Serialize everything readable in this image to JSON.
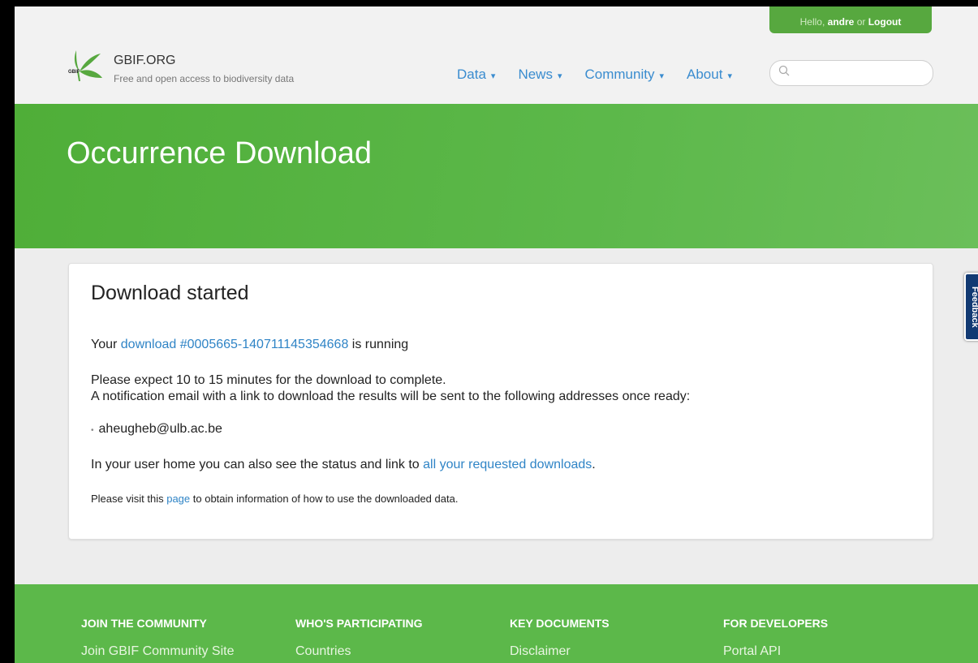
{
  "user_bar": {
    "greeting": "Hello,",
    "username": "andre",
    "separator": "or",
    "logout": "Logout"
  },
  "brand": {
    "logo_text": "GBIF",
    "site_name": "GBIF.ORG",
    "tagline": "Free and open access to biodiversity data",
    "color": "#57a83f"
  },
  "nav": {
    "items": [
      {
        "label": "Data"
      },
      {
        "label": "News"
      },
      {
        "label": "Community"
      },
      {
        "label": "About"
      }
    ],
    "caret": "▾",
    "color": "#3a8ccf"
  },
  "search": {
    "placeholder": "",
    "value": "",
    "icon": "search-icon"
  },
  "hero": {
    "title": "Occurrence Download"
  },
  "card": {
    "title": "Download started",
    "line1": {
      "prefix": "Your",
      "link": "download #0005665-140711145354668",
      "suffix": "is running"
    },
    "line2a": "Please expect 10 to 15 minutes for the download to complete.",
    "line2b": "A notification email with a link to download the results will be sent to the following addresses once ready:",
    "email": "aheugheb@ulb.ac.be",
    "line3": {
      "prefix": "In your user home you can also see the status and link to",
      "link": "all your requested downloads",
      "suffix": "."
    },
    "line4": {
      "prefix": "Please visit this",
      "link": "page",
      "suffix": "to obtain information of how to use the downloaded data."
    }
  },
  "feedback": {
    "label": "Feedback"
  },
  "footer": {
    "columns": [
      {
        "heading": "JOIN THE COMMUNITY",
        "link": "Join GBIF Community Site"
      },
      {
        "heading": "WHO'S PARTICIPATING",
        "link": "Countries"
      },
      {
        "heading": "KEY DOCUMENTS",
        "link": "Disclaimer"
      },
      {
        "heading": "FOR DEVELOPERS",
        "link": "Portal API"
      }
    ]
  },
  "colors": {
    "link": "#2f84c6",
    "hero": "#5cb84a",
    "feedback": "#123a73"
  }
}
